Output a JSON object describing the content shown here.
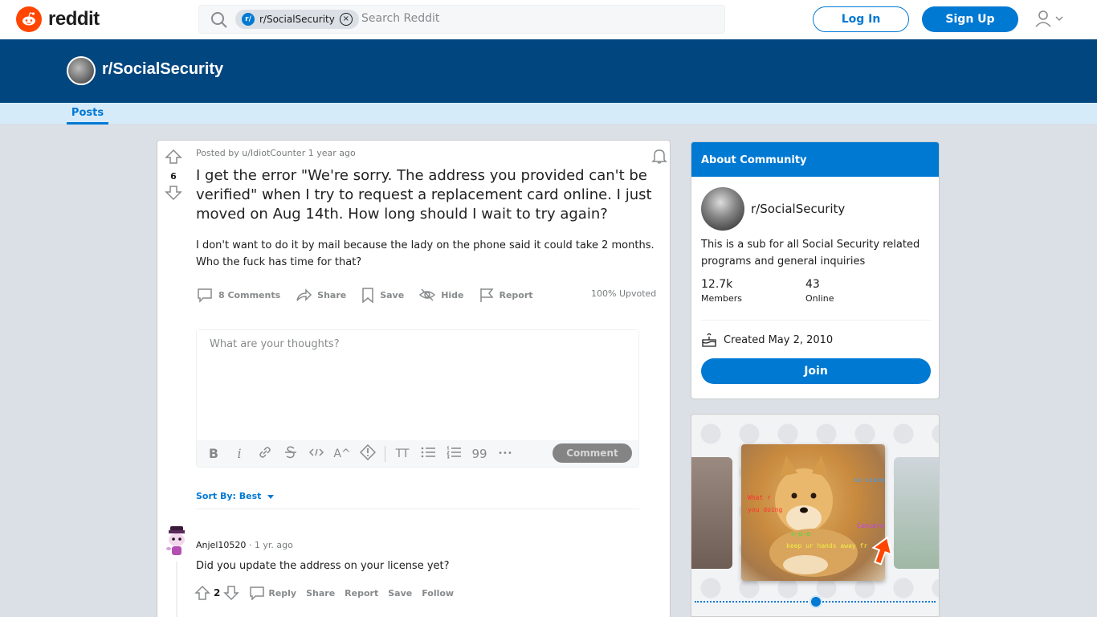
{
  "header": {
    "logo_text": "reddit",
    "search_chip": "r/SocialSecurity",
    "search_chip_badge": "r/",
    "search_placeholder": "Search Reddit",
    "login_label": "Log In",
    "signup_label": "Sign Up"
  },
  "banner": {
    "subreddit": "r/SocialSecurity"
  },
  "tabs": {
    "posts": "Posts"
  },
  "post": {
    "meta": "Posted by u/IdiotCounter 1 year ago",
    "votes": "6",
    "title": "I get the error \"We're sorry. The address you provided can't be verified\" when I try to request a replacement card online. I just moved on Aug 14th. How long should I wait to try again?",
    "body": "I don't want to do it by mail because the lady on the phone said it could take 2 months. Who the fuck has time for that?",
    "actions": {
      "comments": "8 Comments",
      "share": "Share",
      "save": "Save",
      "hide": "Hide",
      "report": "Report"
    },
    "upvoted": "100% Upvoted"
  },
  "comment_box": {
    "placeholder": "What are your thoughts?",
    "submit_label": "Comment",
    "toolbar": {
      "bold": "B",
      "italic": "i",
      "superscript": "A^",
      "heading": "TT",
      "quote": "99",
      "more": "•••"
    }
  },
  "sort": {
    "label": "Sort By: Best"
  },
  "comments": [
    {
      "author": "Anjel10520",
      "time": "· 1 yr. ago",
      "body": "Did you update the address on your license yet?",
      "votes": "2",
      "reply": "Reply",
      "share": "Share",
      "report": "Report",
      "save": "Save",
      "follow": "Follow"
    }
  ],
  "about": {
    "header": "About Community",
    "name": "r/SocialSecurity",
    "description": "This is a sub for all Social Security related programs and general inquiries",
    "members_count": "12.7k",
    "members_label": "Members",
    "online_count": "43",
    "online_label": "Online",
    "created": "Created May 2, 2010",
    "join_label": "Join"
  },
  "promo": {
    "doge_texts": [
      "so scare",
      "What r",
      "you doing",
      "n-p-e",
      "Concern",
      "keep ur hands away fr"
    ]
  },
  "colors": {
    "accent": "#0079d3",
    "banner": "#01467f",
    "brand": "#ff4500"
  }
}
